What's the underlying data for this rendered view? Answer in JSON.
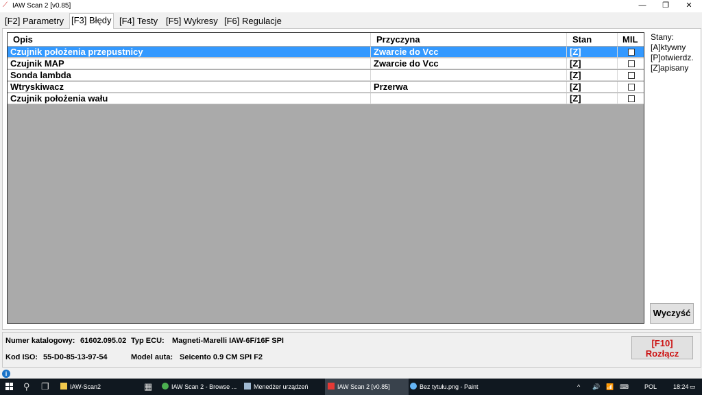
{
  "window": {
    "title": "IAW Scan 2 [v0.85]",
    "minimize": "—",
    "maximize": "❐",
    "close": "✕"
  },
  "tabs": [
    {
      "label": "[F2] Parametry"
    },
    {
      "label": "[F3] Błędy",
      "active": true
    },
    {
      "label": "[F4] Testy"
    },
    {
      "label": "[F5] Wykresy"
    },
    {
      "label": "[F6] Regulacje"
    }
  ],
  "table": {
    "headers": {
      "opis": "Opis",
      "przyczyna": "Przyczyna",
      "stan": "Stan",
      "mil": "MIL"
    },
    "rows": [
      {
        "opis": "Czujnik położenia przepustnicy",
        "przyczyna": "Zwarcie do Vcc",
        "stan": "[Z]",
        "mil": false,
        "selected": true
      },
      {
        "opis": "Czujnik MAP",
        "przyczyna": "Zwarcie do Vcc",
        "stan": "[Z]",
        "mil": false
      },
      {
        "opis": "Sonda lambda",
        "przyczyna": "",
        "stan": "[Z]",
        "mil": false
      },
      {
        "opis": "Wtryskiwacz",
        "przyczyna": "Przerwa",
        "stan": "[Z]",
        "mil": false
      },
      {
        "opis": "Czujnik położenia wału",
        "przyczyna": "",
        "stan": "[Z]",
        "mil": false
      }
    ]
  },
  "legend": {
    "title": "Stany:",
    "items": [
      "[A]ktywny",
      "[P]otwierdz.",
      "[Z]apisany"
    ]
  },
  "clear_button": "Wyczyść",
  "info": {
    "catalog_label": "Numer katalogowy:",
    "catalog_value": "61602.095.02",
    "ecu_label": "Typ ECU:",
    "ecu_value": "Magneti-Marelli IAW-6F/16F SPI",
    "iso_label": "Kod ISO:",
    "iso_value": "55-D0-85-13-97-54",
    "model_label": "Model auta:",
    "model_value": "Seicento 0.9 CM SPI F2"
  },
  "disconnect_button": {
    "line1": "[F10]",
    "line2": "Rozłącz"
  },
  "info_icon": "i",
  "taskbar": {
    "items": [
      {
        "label": "IAW-Scan2",
        "color": "#f2c94c"
      },
      {
        "label": "IAW Scan 2 - Browse ...",
        "color": "#4caf50"
      },
      {
        "label": "Menedżer urządzeń",
        "color": "#9fb8d0"
      },
      {
        "label": "IAW Scan 2 [v0.85]",
        "color": "#e53935",
        "active": true
      },
      {
        "label": "Bez tytułu.png - Paint",
        "color": "#64b5f6"
      }
    ],
    "language": "POL",
    "time": "18:24"
  },
  "colors": {
    "selection": "#3399ff",
    "grid_bg": "#aaaaaa",
    "disconnect_text": "#cc1111"
  }
}
